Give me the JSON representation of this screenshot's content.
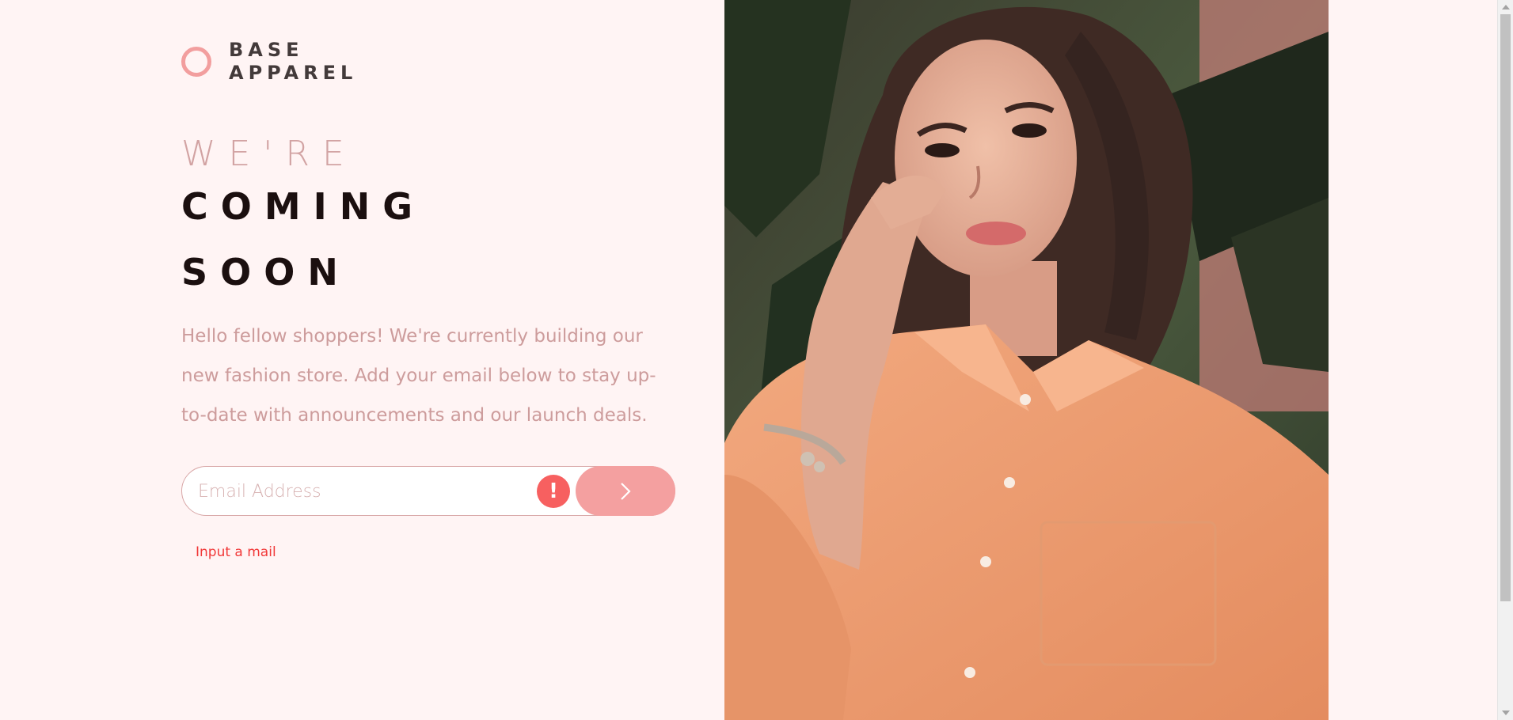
{
  "brand": {
    "line1": "BASE",
    "line2": "APPAREL",
    "accent_color": "#f29e9e"
  },
  "headline": {
    "light": "WE'RE",
    "bold_line1": "COMING",
    "bold_line2": "SOON"
  },
  "description": "Hello fellow shoppers! We're currently building our new fashion store. Add your email below to stay up-to-date with announcements and our launch deals.",
  "form": {
    "email_placeholder": "Email Address",
    "email_value": "",
    "error_icon": "!",
    "submit_icon": "chevron-right-icon",
    "error_message": "Input a mail",
    "error_color": "#f13939"
  },
  "hero_image": {
    "subject": "woman-in-orange-shirt-photo"
  }
}
